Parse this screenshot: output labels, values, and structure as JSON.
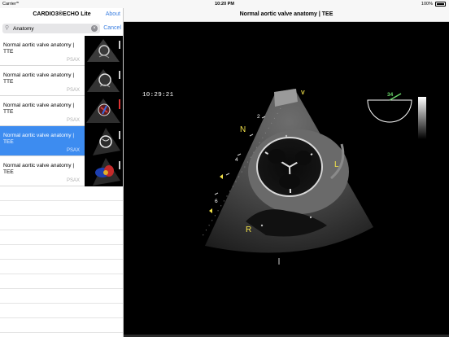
{
  "status_bar": {
    "carrier": "Carrier",
    "time": "10:20 PM",
    "battery": "100%"
  },
  "sidebar": {
    "title": "CARDIO3®ECHO Lite",
    "about_label": "About",
    "search": {
      "value": "Anatomy",
      "cancel_label": "Cancel"
    },
    "results": [
      {
        "title": "Normal aortic valve anatomy | TTE",
        "tag": "PSAX"
      },
      {
        "title": "Normal aortic valve anatomy | TTE",
        "tag": "PSAX"
      },
      {
        "title": "Normal aortic valve anatomy | TTE",
        "tag": "PSAX"
      },
      {
        "title": "Normal aortic valve anatomy | TEE",
        "tag": "PSAX"
      },
      {
        "title": "Normal aortic valve anatomy | TEE",
        "tag": "PSAX"
      }
    ]
  },
  "detail": {
    "title": "Normal aortic valve anatomy | TEE",
    "clock": "10:29:21",
    "angle": "34",
    "markers": {
      "n": "N",
      "l": "L",
      "r": "R",
      "v": "V"
    },
    "depths": [
      "2",
      "4",
      "6"
    ]
  },
  "colors": {
    "accent": "#3a7ee0",
    "selected": "#3d8cf0",
    "marker": "#f3e24a",
    "angle": "#6ad66a"
  }
}
